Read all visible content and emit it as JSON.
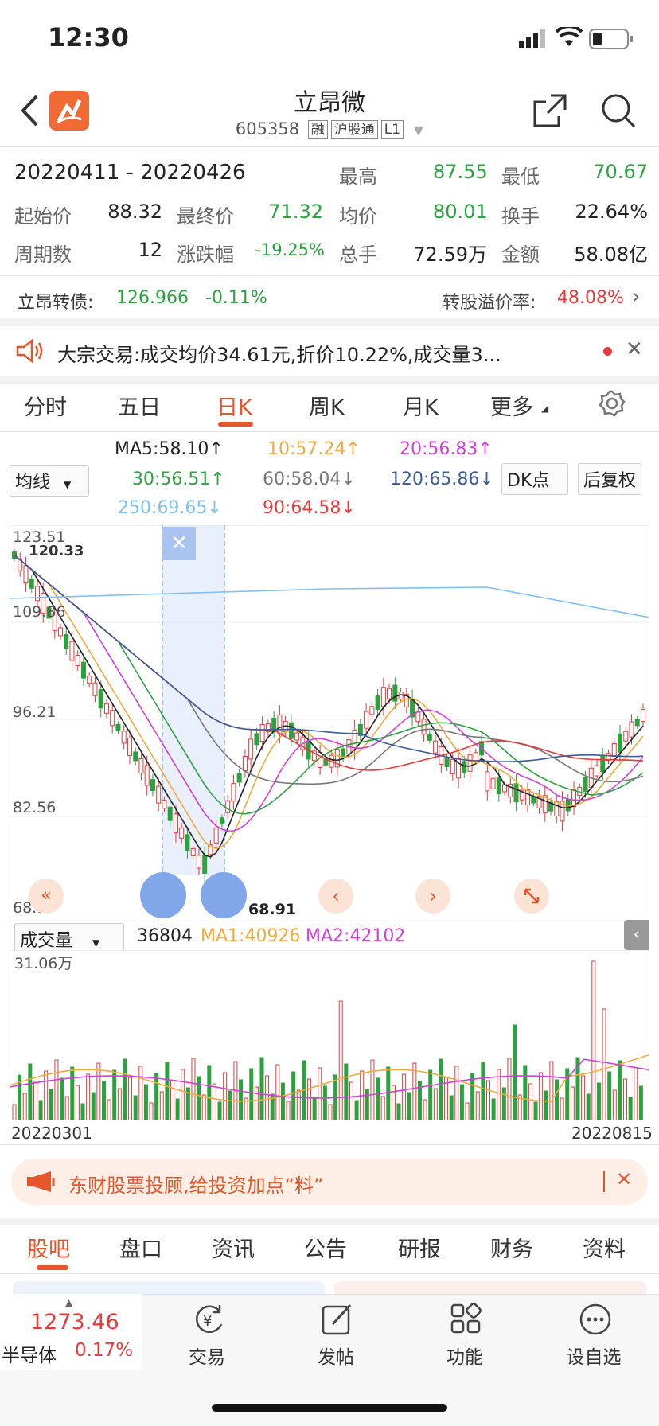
{
  "status": {
    "time": "12:30"
  },
  "nav": {
    "title": "立昂微",
    "code": "605358",
    "tags": [
      "融",
      "沪股通",
      "L1"
    ]
  },
  "summary": {
    "date_range": "20220411  -  20220426",
    "rows": [
      [
        {
          "label": "起始价",
          "value": "88.32"
        },
        {
          "label": "最终价",
          "value": "71.32"
        },
        {
          "label": "均价",
          "value": "80.01"
        },
        {
          "label": "换手",
          "value": "22.64%"
        }
      ],
      [
        {
          "label": "周期数",
          "value": "12"
        },
        {
          "label": "涨跌幅",
          "value": "-19.25%"
        },
        {
          "label": "总手",
          "value": "72.59万"
        },
        {
          "label": "金额",
          "value": "58.08亿"
        }
      ]
    ],
    "high_label": "最高",
    "high": "87.55",
    "low_label": "最低",
    "low": "70.67"
  },
  "bond": {
    "name": "立昂转债:",
    "price": "126.966",
    "change": "-0.11%",
    "premium_label": "转股溢价率:",
    "premium": "48.08%"
  },
  "notice": {
    "text": "大宗交易:成交均价34.61元,折价10.22%,成交量3..."
  },
  "tabs": [
    "分时",
    "五日",
    "日K",
    "周K",
    "月K",
    "更多"
  ],
  "ma": {
    "selector": "均线",
    "ma5": "MA5:58.10↑",
    "ma10": "10:57.24↑",
    "ma20": "20:56.83↑",
    "ma30": "30:56.51↑",
    "ma60": "60:58.04↓",
    "ma120": "120:65.86↓",
    "ma250": "250:69.65↓",
    "ma90": "90:64.58↓",
    "dk": "DK点",
    "fq": "后复权"
  },
  "chart_labels": {
    "y1": "123.51",
    "y1b": "120.33",
    "y2": "109.86",
    "y3": "96.21",
    "y4": "82.56",
    "y5": "68.9",
    "min_mark": "68.91"
  },
  "volume": {
    "selector": "成交量",
    "value": "36804",
    "ma1": "MA1:40926",
    "ma2": "MA2:42102",
    "max": "31.06万",
    "start_date": "20220301",
    "end_date": "20220815"
  },
  "ad": {
    "text": "东财股票投顾,给投资加点“料”"
  },
  "bottom_tabs": [
    "股吧",
    "盘口",
    "资讯",
    "公告",
    "研报",
    "财务",
    "资料"
  ],
  "dock": {
    "index_value": "1273.46",
    "index_name": "半导体",
    "index_change": "0.17%",
    "items": [
      "交易",
      "发帖",
      "功能",
      "设自选"
    ]
  },
  "colors": {
    "accent": "#e5562b",
    "up": "#e6393b",
    "down": "#2aa33f",
    "ma5": "#222222",
    "ma10": "#f2a93b",
    "ma20": "#d23fd6",
    "ma30": "#2aa33f",
    "ma60": "#777777",
    "ma120": "#3a5a9a",
    "ma250": "#7fbff2",
    "ma90": "#e6393b"
  },
  "chart_data": {
    "type": "candlestick",
    "x_range": [
      "20220301",
      "20220815"
    ],
    "y_ticks": [
      123.51,
      109.86,
      96.21,
      82.56,
      68.9
    ],
    "ylim": [
      68.9,
      123.51
    ],
    "highlighted_range": [
      "20220411",
      "20220426"
    ],
    "min_price": 68.91,
    "volume_max": "31.06万"
  }
}
